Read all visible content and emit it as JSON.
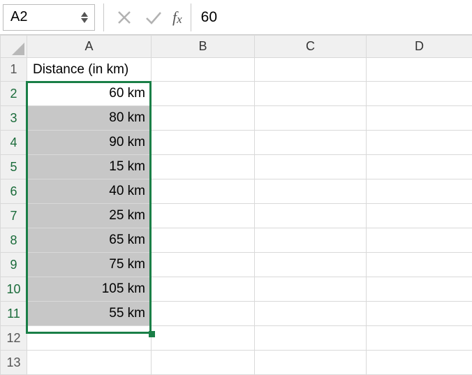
{
  "formula_bar": {
    "name_box": "A2",
    "formula_value": "60"
  },
  "columns": {
    "A": "A",
    "B": "B",
    "C": "C",
    "D": "D"
  },
  "rows": {
    "r1": "1",
    "r2": "2",
    "r3": "3",
    "r4": "4",
    "r5": "5",
    "r6": "6",
    "r7": "7",
    "r8": "8",
    "r9": "9",
    "r10": "10",
    "r11": "11",
    "r12": "12",
    "r13": "13"
  },
  "cells": {
    "A1": "Distance (in km)",
    "A2": "60 km",
    "A3": "80 km",
    "A4": "90 km",
    "A5": "15 km",
    "A6": "40 km",
    "A7": "25 km",
    "A8": "65 km",
    "A9": "75 km",
    "A10": "105 km",
    "A11": "55 km"
  },
  "selection": {
    "active_cell": "A2",
    "range": "A2:A11"
  },
  "colors": {
    "selection_border": "#1a7f47",
    "selection_fill": "#c7c7c7",
    "header_selected_text": "#1a6b3a"
  }
}
